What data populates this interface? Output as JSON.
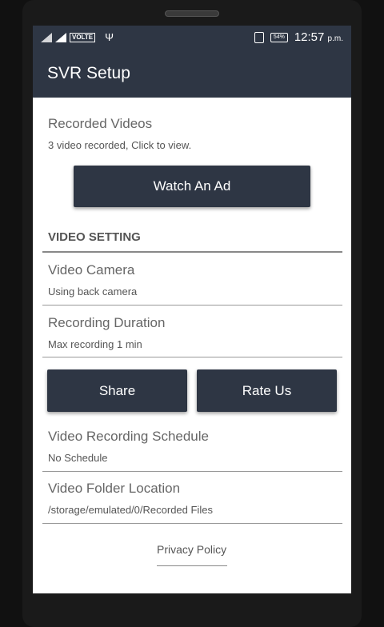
{
  "status": {
    "volte": "VOLTE",
    "usb_icon": "usb-icon",
    "battery": "54%",
    "time": "12:57",
    "ampm": "p.m."
  },
  "appbar": {
    "title": "SVR Setup"
  },
  "recorded": {
    "title": "Recorded Videos",
    "subtitle": "3 video recorded, Click to view."
  },
  "ad_button": "Watch An Ad",
  "section": "VIDEO SETTING",
  "camera": {
    "title": "Video Camera",
    "subtitle": "Using back camera"
  },
  "duration": {
    "title": "Recording Duration",
    "subtitle": "Max recording 1 min"
  },
  "share_button": "Share",
  "rate_button": "Rate Us",
  "schedule": {
    "title": "Video Recording Schedule",
    "subtitle": "No Schedule"
  },
  "folder": {
    "title": "Video Folder Location",
    "subtitle": "/storage/emulated/0/Recorded Files"
  },
  "privacy": "Privacy Policy"
}
